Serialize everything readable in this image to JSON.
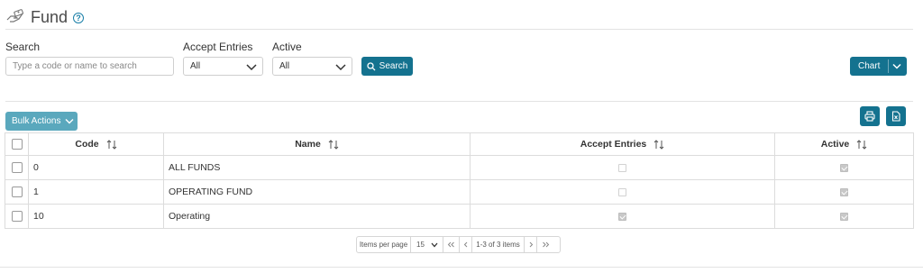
{
  "header": {
    "title": "Fund",
    "help_glyph": "?",
    "logo_icon": "fund-hand-money-icon"
  },
  "filters": {
    "search_label": "Search",
    "search_placeholder": "Type a code or name to search",
    "accept_entries_label": "Accept Entries",
    "accept_entries_value": "All",
    "active_label": "Active",
    "active_value": "All",
    "search_button": "Search"
  },
  "toolbar": {
    "chart_button": "Chart",
    "bulk_actions": "Bulk Actions"
  },
  "table": {
    "columns": [
      "Code",
      "Name",
      "Accept Entries",
      "Active"
    ],
    "rows": [
      {
        "code": "0",
        "name": "ALL FUNDS",
        "accept_entries": false,
        "active": true
      },
      {
        "code": "1",
        "name": "OPERATING FUND",
        "accept_entries": false,
        "active": true
      },
      {
        "code": "10",
        "name": "Operating",
        "accept_entries": true,
        "active": true
      }
    ]
  },
  "pagination": {
    "items_per_page_label": "Items per page",
    "page_size": "15",
    "range": "1-3 of 3 items"
  },
  "colors": {
    "primary": "#14728f",
    "bulk": "#5aa8bd"
  }
}
